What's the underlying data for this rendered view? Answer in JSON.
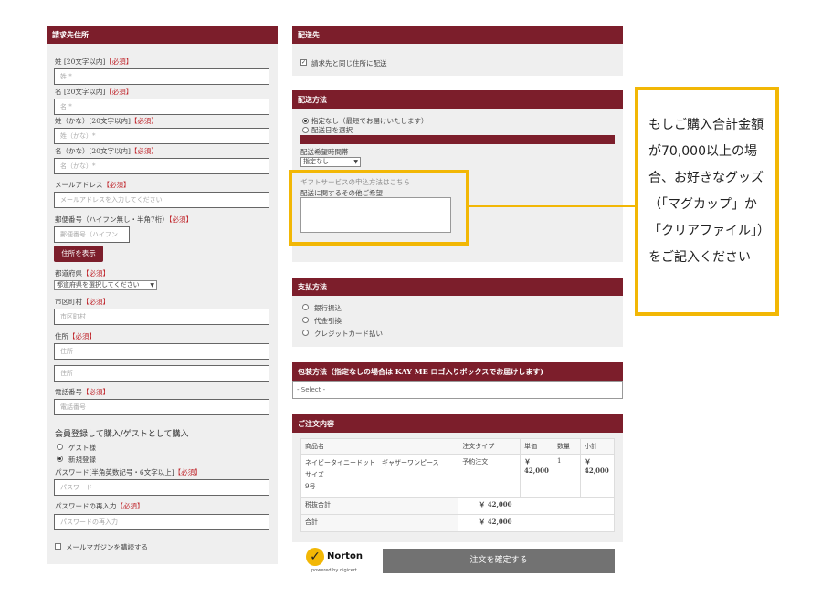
{
  "billing": {
    "header": "請求先住所",
    "req": "【必須】",
    "last_name_label": "姓 [20文字以内]",
    "last_name_ph": "姓 *",
    "first_name_label": "名 [20文字以内]",
    "first_name_ph": "名 *",
    "last_kana_label": "姓（かな）[20文字以内]",
    "last_kana_ph": "姓（かな）*",
    "first_kana_label": "名（かな）[20文字以内]",
    "first_kana_ph": "名（かな）*",
    "email_label": "メールアドレス",
    "email_ph": "メールアドレスを入力してください",
    "zip_label": "郵便番号（ハイフン無し・半角7桁）",
    "zip_ph": "郵便番号（ハイフン",
    "address_button": "住所を表示",
    "pref_label": "都道府県",
    "pref_select": "都道府県を選択してください",
    "city_label": "市区町村",
    "city_ph": "市区町村",
    "addr_label": "住所",
    "addr_ph": "住所",
    "addr2_ph": "住所",
    "phone_label": "電話番号",
    "phone_ph": "電話番号",
    "member_title": "会員登録して購入/ゲストとして購入",
    "guest_option": "ゲスト様",
    "new_option": "新規登録",
    "password_label": "パスワード[半角英数記号・6文字以上]",
    "password_ph": "パスワード",
    "password2_label": "パスワードの再入力",
    "password2_ph": "パスワードの再入力",
    "newsletter_label": "メールマガジンを購読する"
  },
  "shipping": {
    "header": "配送先",
    "same_address": "請求先と同じ住所に配送"
  },
  "delivery": {
    "header": "配送方法",
    "option_none": "指定なし（最短でお届けいたします）",
    "option_date": "配送日を選択",
    "time_label": "配送希望時間帯",
    "time_select": "指定なし",
    "gift_note": "ギフトサービスの申込方法はこちら",
    "request_label": "配送に関するその他ご希望"
  },
  "payment": {
    "header": "支払方法",
    "options": [
      "銀行振込",
      "代金引換",
      "クレジットカード払い"
    ]
  },
  "wrapping": {
    "header": "包装方法（指定なしの場合は KAY ME ロゴ入りボックスでお届けします)",
    "select": "- Select -"
  },
  "order": {
    "header": "ご注文内容",
    "columns": [
      "商品名",
      "注文タイプ",
      "単価",
      "数量",
      "小計"
    ],
    "product_name_line1": "ネイビータイニードット　ギャザーワンピース",
    "product_name_line2": "サイズ",
    "product_name_line3": "9号",
    "order_type": "予約注文",
    "unit_price": "￥ 42,000",
    "quantity": "1",
    "subtotal": "￥ 42,000",
    "tax_excluded_label": "税抜合計",
    "tax_excluded_value": "￥ 42,000",
    "total_label": "合計",
    "total_value": "￥ 42,000",
    "confirm_button": "注文を確定する"
  },
  "badge": {
    "norton": "Norton",
    "powered": "powered by digicert"
  },
  "callout": {
    "text": "もしご購入合計金額が70,000以上の場合、お好きなグッズ（「マグカップ」か「クリアファイル」）をご記入ください"
  },
  "colors": {
    "header_bg": "#7c1e2b",
    "highlight": "#f2b705",
    "required": "#c0272d"
  }
}
